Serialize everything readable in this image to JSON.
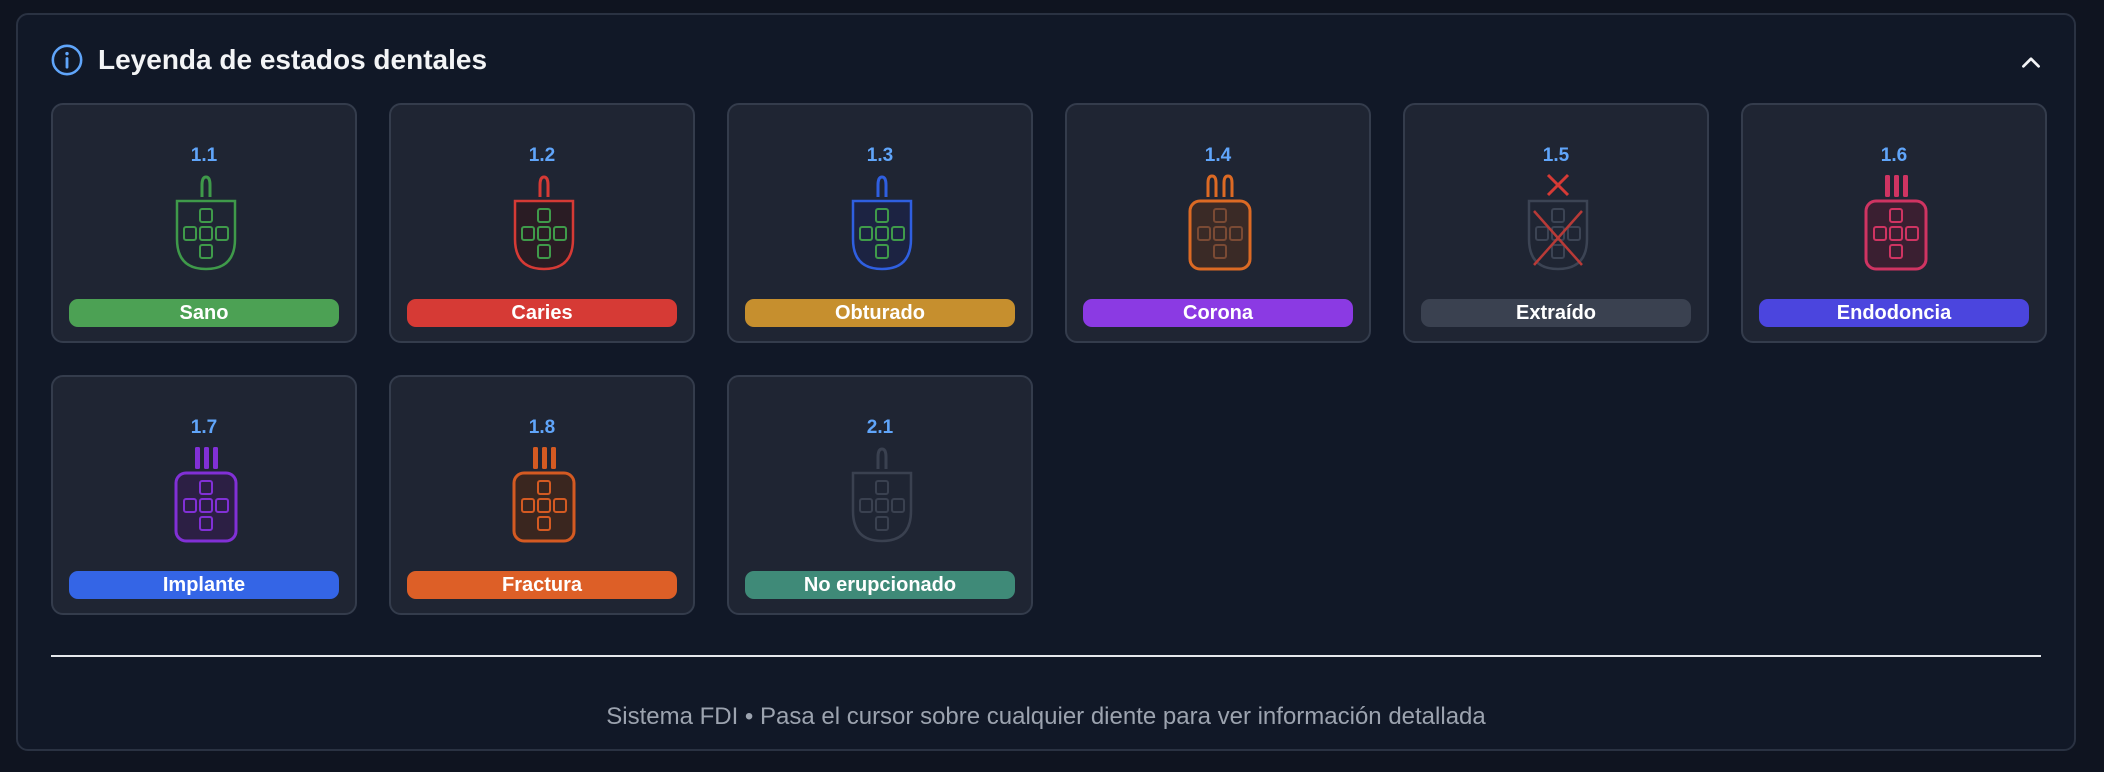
{
  "legend": {
    "title": "Leyenda de estados dentales",
    "info_icon": "info-circle-icon",
    "collapse_icon": "chevron-up-icon",
    "footer": "Sistema FDI • Pasa el cursor sobre cualquier diente para ver información detallada",
    "items": [
      {
        "code": "1.1",
        "label": "Sano",
        "color": "#4ca154",
        "tooth_color": "#3f9a4a",
        "inner_color": "#3f9a4a",
        "style": "incisor",
        "roots": 1,
        "fill": "none"
      },
      {
        "code": "1.2",
        "label": "Caries",
        "color": "#d63a35",
        "tooth_color": "#d63a35",
        "inner_color": "#3f9a4a",
        "style": "incisor",
        "roots": 1,
        "fill": "#2a1c24"
      },
      {
        "code": "1.3",
        "label": "Obturado",
        "color": "#c68f2e",
        "tooth_color": "#2f5fe0",
        "inner_color": "#3f9a4a",
        "style": "incisor",
        "roots": 1,
        "fill": "#1c2342"
      },
      {
        "code": "1.4",
        "label": "Corona",
        "color": "#8b3ae3",
        "tooth_color": "#dc6a24",
        "inner_color": "#7a4a34",
        "style": "crown",
        "roots": 2,
        "fill": "#3a2a26"
      },
      {
        "code": "1.5",
        "label": "Extraído",
        "color": "#3a4150",
        "tooth_color": "#3c4454",
        "inner_color": "#3c4454",
        "style": "extracted",
        "roots": 0,
        "fill": "none"
      },
      {
        "code": "1.6",
        "label": "Endodoncia",
        "color": "#4b45de",
        "tooth_color": "#cf3462",
        "inner_color": "#cf3462",
        "style": "crown",
        "roots": 3,
        "fill": "#3a1f31"
      },
      {
        "code": "1.7",
        "label": "Implante",
        "color": "#3465e6",
        "tooth_color": "#8130d6",
        "inner_color": "#8130d6",
        "style": "crown",
        "roots": 3,
        "fill": "#2c1f44"
      },
      {
        "code": "1.8",
        "label": "Fractura",
        "color": "#dd5f27",
        "tooth_color": "#d45a22",
        "inner_color": "#d45a22",
        "style": "crown",
        "roots": 3,
        "fill": "#3a261f"
      },
      {
        "code": "2.1",
        "label": "No erupcionado",
        "color": "#3f8a78",
        "tooth_color": "#3a4150",
        "inner_color": "#3a4150",
        "style": "incisor",
        "roots": 1,
        "fill": "none"
      }
    ]
  }
}
